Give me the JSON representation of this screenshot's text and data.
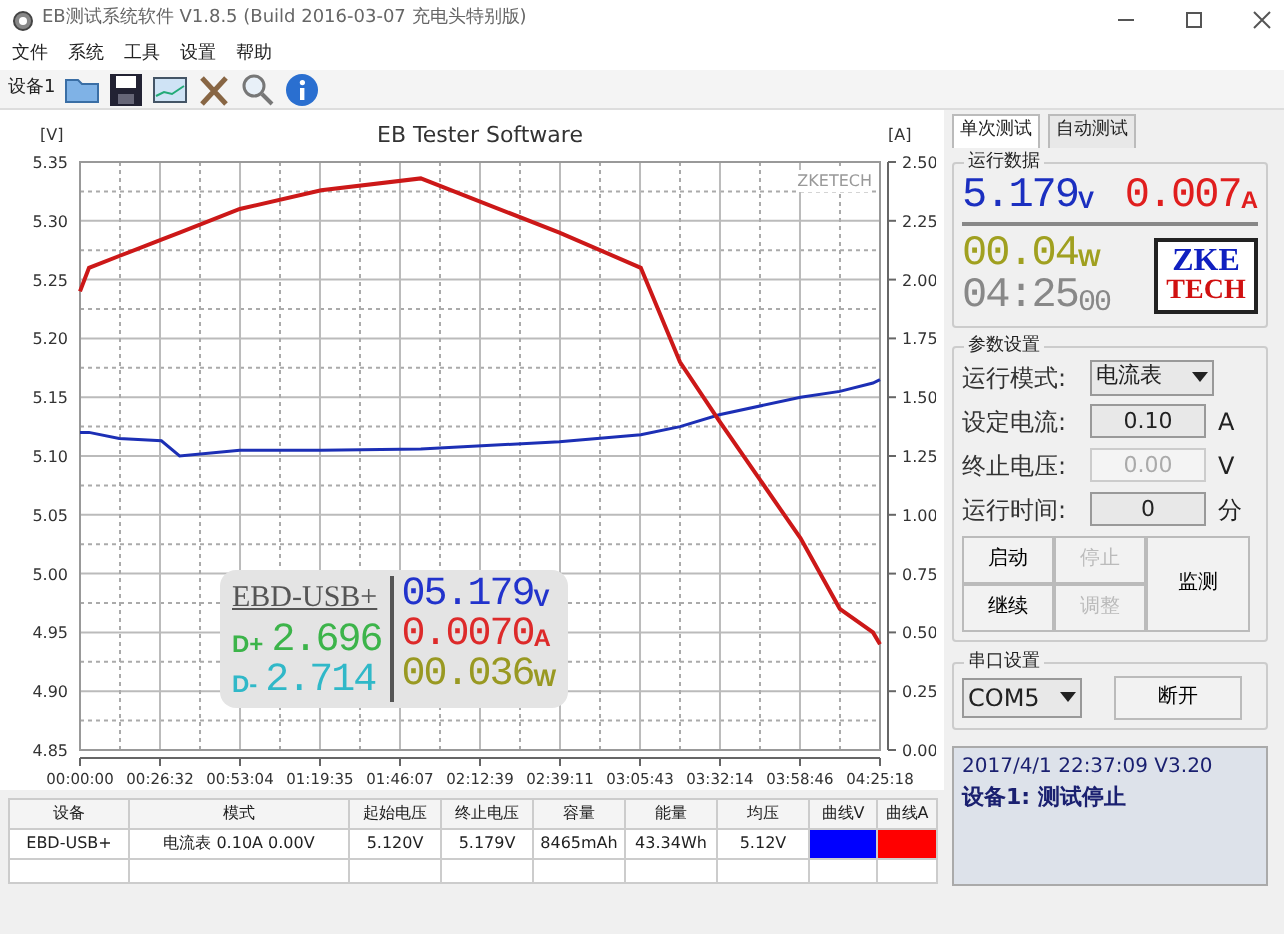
{
  "window": {
    "title": "EB测试系统软件 V1.8.5 (Build 2016-03-07 充电头特别版)"
  },
  "menu": [
    "文件",
    "系统",
    "工具",
    "设置",
    "帮助"
  ],
  "toolbar": {
    "device_label": "设备1"
  },
  "chart": {
    "brand": "ZKETECH",
    "chart_data": {
      "type": "line",
      "title": "EB Tester Software",
      "ylabel": "[V]",
      "y2label": "[A]",
      "grid": true,
      "x": [
        0,
        180,
        780,
        1620,
        1980,
        3180,
        4800,
        6780,
        9540,
        11160,
        11940,
        12720,
        14340,
        15120,
        15780,
        15918
      ],
      "xlim": [
        0,
        15918
      ],
      "xticks": [
        {
          "value": 0,
          "label": "00:00:00"
        },
        {
          "value": 1592,
          "label": "00:26:32"
        },
        {
          "value": 3184,
          "label": "00:53:04"
        },
        {
          "value": 4775,
          "label": "01:19:35"
        },
        {
          "value": 6367,
          "label": "01:46:07"
        },
        {
          "value": 7959,
          "label": "02:12:39"
        },
        {
          "value": 9551,
          "label": "02:39:11"
        },
        {
          "value": 11143,
          "label": "03:05:43"
        },
        {
          "value": 12734,
          "label": "03:32:14"
        },
        {
          "value": 14326,
          "label": "03:58:46"
        },
        {
          "value": 15918,
          "label": "04:25:18"
        }
      ],
      "ylim": [
        4.85,
        5.35
      ],
      "yticks": [
        {
          "value": 4.85,
          "label": "4.85"
        },
        {
          "value": 4.9,
          "label": "4.90"
        },
        {
          "value": 4.95,
          "label": "4.95"
        },
        {
          "value": 5.0,
          "label": "5.00"
        },
        {
          "value": 5.05,
          "label": "5.05"
        },
        {
          "value": 5.1,
          "label": "5.10"
        },
        {
          "value": 5.15,
          "label": "5.15"
        },
        {
          "value": 5.2,
          "label": "5.20"
        },
        {
          "value": 5.25,
          "label": "5.25"
        },
        {
          "value": 5.3,
          "label": "5.30"
        },
        {
          "value": 5.35,
          "label": "5.35"
        }
      ],
      "y2lim": [
        0,
        2.5
      ],
      "y2ticks": [
        {
          "value": 0,
          "label": "0.00"
        },
        {
          "value": 0.25,
          "label": "0.25"
        },
        {
          "value": 0.5,
          "label": "0.50"
        },
        {
          "value": 0.75,
          "label": "0.75"
        },
        {
          "value": 1.0,
          "label": "1.00"
        },
        {
          "value": 1.25,
          "label": "1.25"
        },
        {
          "value": 1.5,
          "label": "1.50"
        },
        {
          "value": 1.75,
          "label": "1.75"
        },
        {
          "value": 2.0,
          "label": "2.00"
        },
        {
          "value": 2.25,
          "label": "2.25"
        },
        {
          "value": 2.5,
          "label": "2.50"
        }
      ],
      "series": [
        {
          "color": "#1c2fb5",
          "values": [
            5.12,
            5.12,
            5.115,
            5.113,
            5.1,
            5.105,
            5.105,
            5.106,
            5.112,
            5.118,
            5.125,
            5.135,
            5.15,
            5.155,
            5.162,
            5.165
          ]
        },
        {
          "color": "#cc1818",
          "axis": "y2",
          "values": [
            1.95,
            2.05,
            2.1,
            2.17,
            2.2,
            2.3,
            2.38,
            2.43,
            2.2,
            2.05,
            1.65,
            1.4,
            0.9,
            0.6,
            0.5,
            0.45
          ]
        }
      ]
    }
  },
  "overlay": {
    "device": "EBD-USB+",
    "d_plus_label": "D+",
    "d_plus": "2.696",
    "d_minus_label": "D-",
    "d_minus": "2.714",
    "voltage": "05.179",
    "voltage_unit": "V",
    "current": "0.0070",
    "current_unit": "A",
    "power": "00.036",
    "power_unit": "W"
  },
  "table": {
    "columns": [
      "设备",
      "模式",
      "起始电压",
      "终止电压",
      "容量",
      "能量",
      "均压",
      "曲线V",
      "曲线A"
    ],
    "rows": [
      {
        "cells": [
          "EBD-USB+",
          "电流表  0.10A  0.00V",
          "5.120V",
          "5.179V",
          "8465mAh",
          "43.34Wh",
          "5.12V"
        ],
        "curves": [
          {
            "color": "#0000ff"
          },
          {
            "color": "#ff0000"
          }
        ]
      }
    ]
  },
  "tabs": [
    {
      "label": "单次测试",
      "selected": true
    },
    {
      "label": "自动测试",
      "selected": false
    }
  ],
  "run_data": {
    "title": "运行数据",
    "voltage": "5.179",
    "voltage_unit": "V",
    "current": "0.007",
    "current_unit": "A",
    "power": "00.04",
    "power_unit": "W",
    "time": "04:25",
    "time_seconds": "00",
    "logo_top": "ZKE",
    "logo_bottom": "TECH"
  },
  "params": {
    "title": "参数设置",
    "fields": [
      {
        "kind": "select",
        "label": "运行模式:",
        "value": "电流表"
      },
      {
        "kind": "input",
        "label": "设定电流:",
        "value": "0.10",
        "unit": "A",
        "disabled": false
      },
      {
        "kind": "input",
        "label": "终止电压:",
        "value": "0.00",
        "unit": "V",
        "disabled": true
      },
      {
        "kind": "input",
        "label": "运行时间:",
        "value": "0",
        "unit": "分",
        "disabled": false
      }
    ],
    "buttons": [
      {
        "label": "启动",
        "kind": "normal",
        "disabled": false
      },
      {
        "label": "停止",
        "kind": "normal",
        "disabled": true
      },
      {
        "label": "监测",
        "kind": "tall",
        "disabled": false
      },
      {
        "label": "继续",
        "kind": "normal",
        "disabled": false
      },
      {
        "label": "调整",
        "kind": "normal",
        "disabled": true
      }
    ]
  },
  "serial": {
    "title": "串口设置",
    "port": "COM5",
    "button": "断开"
  },
  "status": {
    "lines": [
      "2017/4/1 22:37:09  V3.20",
      "设备1: 测试停止"
    ]
  }
}
